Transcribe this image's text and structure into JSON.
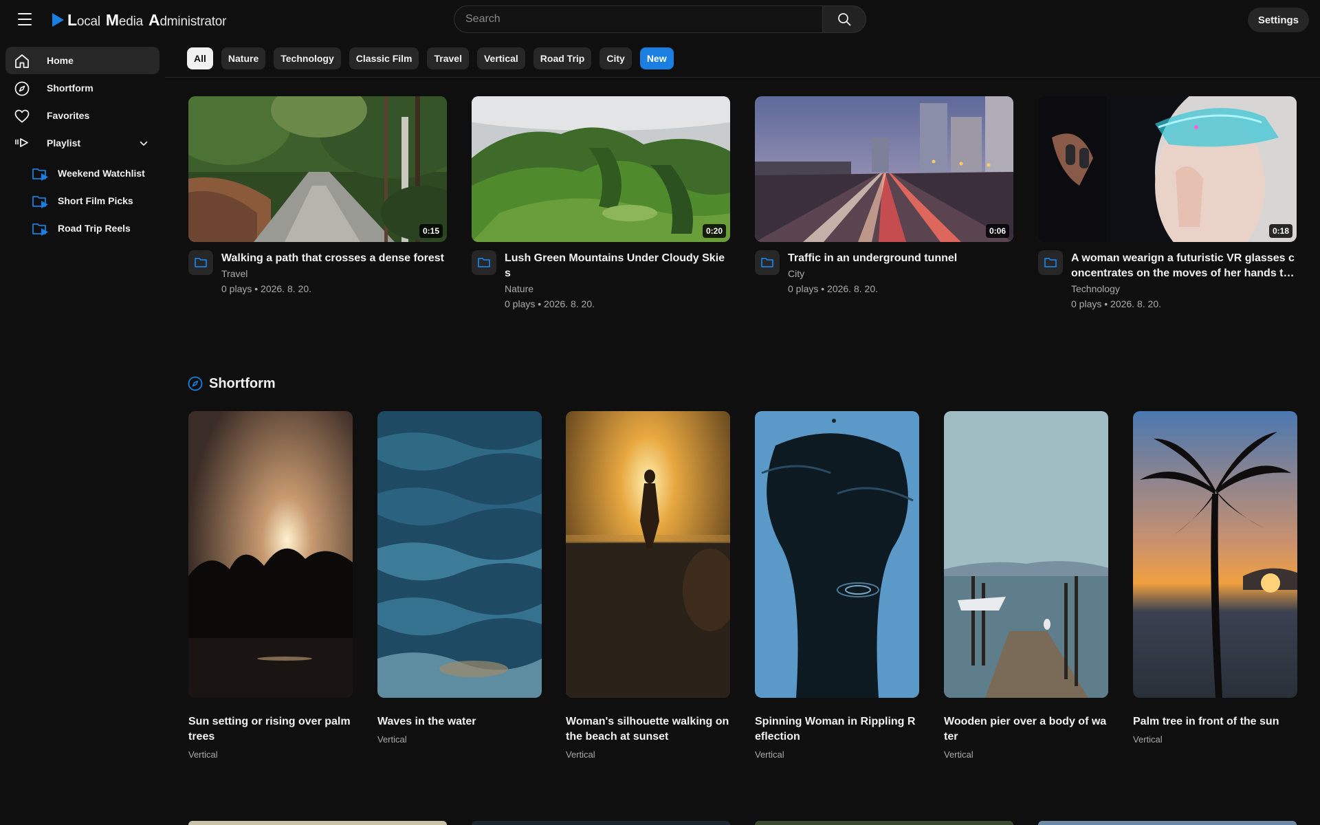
{
  "app": {
    "logo_words": [
      {
        "cap": "L",
        "rest": "ocal"
      },
      {
        "cap": "M",
        "rest": "edia"
      },
      {
        "cap": "A",
        "rest": "dministrator"
      }
    ],
    "brand_color": "#1a7fe0"
  },
  "header": {
    "menu_icon": "hamburger-icon",
    "search_placeholder": "Search",
    "search_icon": "search-icon",
    "settings_label": "Settings"
  },
  "sidebar": {
    "items": [
      {
        "label": "Home",
        "icon": "home-icon",
        "active": true
      },
      {
        "label": "Shortform",
        "icon": "compass-icon"
      },
      {
        "label": "Favorites",
        "icon": "heart-icon"
      },
      {
        "label": "Playlist",
        "icon": "playlist-icon",
        "expanded": true
      }
    ],
    "playlists": [
      {
        "label": "Weekend Watchlist",
        "icon": "playlist-folder-icon"
      },
      {
        "label": "Short Film Picks",
        "icon": "playlist-folder-icon"
      },
      {
        "label": "Road Trip Reels",
        "icon": "playlist-folder-icon"
      }
    ]
  },
  "chips": [
    {
      "label": "All",
      "state": "selected"
    },
    {
      "label": "Nature"
    },
    {
      "label": "Technology"
    },
    {
      "label": "Classic Film"
    },
    {
      "label": "Travel"
    },
    {
      "label": "Vertical"
    },
    {
      "label": "Road Trip"
    },
    {
      "label": "City"
    },
    {
      "label": "New",
      "state": "new"
    }
  ],
  "videos": [
    {
      "title": "Walking a path that crosses a dense forest",
      "category": "Travel",
      "stats": "0 plays • 2026. 8. 20.",
      "duration": "0:15",
      "thumb": "forest-path"
    },
    {
      "title": "Lush Green Mountains Under Cloudy Skies",
      "category": "Nature",
      "stats": "0 plays • 2026. 8. 20.",
      "duration": "0:20",
      "thumb": "green-mountains"
    },
    {
      "title": "Traffic in an underground tunnel",
      "category": "City",
      "stats": "0 plays • 2026. 8. 20.",
      "duration": "0:06",
      "thumb": "city-traffic"
    },
    {
      "title": "A woman wearign a futuristic VR glasses concentrates on the moves of her hands to co...",
      "category": "Technology",
      "stats": "0 plays • 2026. 8. 20.",
      "duration": "0:18",
      "thumb": "vr-woman"
    }
  ],
  "shortform": {
    "title": "Shortform",
    "icon": "compass-icon",
    "items": [
      {
        "title": "Sun setting or rising over palm trees",
        "category": "Vertical",
        "thumb": "palm-sunset"
      },
      {
        "title": "Waves in the water",
        "category": "Vertical",
        "thumb": "waves"
      },
      {
        "title": "Woman's silhouette walking on the beach at sunset",
        "category": "Vertical",
        "thumb": "beach-silhouette"
      },
      {
        "title": "Spinning Woman in Rippling Reflection",
        "category": "Vertical",
        "thumb": "ripple-reflection"
      },
      {
        "title": "Wooden pier over a body of water",
        "category": "Vertical",
        "thumb": "wooden-pier"
      },
      {
        "title": "Palm tree in front of the sun",
        "category": "Vertical",
        "thumb": "palm-tree-sun"
      }
    ]
  }
}
